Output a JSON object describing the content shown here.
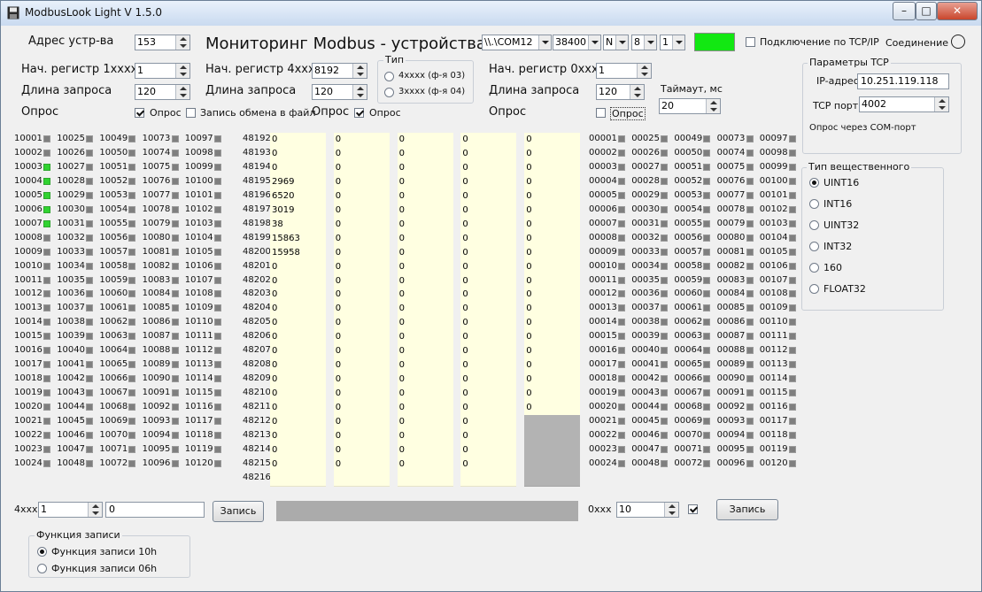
{
  "window": {
    "title": "ModbusLook Light V 1.5.0",
    "min": "–",
    "max": "□",
    "close": "✕"
  },
  "top": {
    "device_address_label": "Адрес устр-ва",
    "device_address": "153",
    "heading": "Мониторинг Modbus - устройства",
    "com_port": "\\\\.\\COM12",
    "baud": "38400",
    "parity": "N",
    "data_bits": "8",
    "stop_bits": "1",
    "status_color": "#12e812",
    "tcp_checkbox_label": "Подключение по TCP/IP",
    "tcp_checked": false,
    "connection_label": "Соединение"
  },
  "panel_1x": {
    "start_label": "Нач. регистр  1xxxx",
    "start": "1",
    "length_label": "Длина запроса",
    "length": "120",
    "poll_label": "Опрос",
    "poll_check_label": "Опрос",
    "poll_checked": true,
    "log_check_label": "Запись обмена в файл",
    "log_checked": false
  },
  "panel_4x": {
    "start_label": "Нач. регистр  4xxxx",
    "start": "8192",
    "length_label": "Длина запроса",
    "length": "120",
    "poll_label": "Опрос",
    "poll_check_label": "Опрос",
    "poll_checked": true,
    "type_group_title": "Тип",
    "type_options": [
      {
        "label": "4xxxx (ф-я 03)",
        "selected": false
      },
      {
        "label": "3xxxx (ф-я 04)",
        "selected": false
      }
    ]
  },
  "panel_0x": {
    "start_label": "Нач. регистр  0xxxx",
    "start": "1",
    "length_label": "Длина запроса",
    "length": "120",
    "poll_label": "Опрос",
    "poll_check_label": "Опрос",
    "poll_checked": false,
    "timeout_label": "Таймаут, мс",
    "timeout": "20"
  },
  "tcp_params": {
    "title": "Параметры TCP",
    "ip_label": "IP-адрес",
    "ip": "10.251.119.118",
    "port_label": "TCP порт",
    "port": "4002",
    "note": "Опрос через COM-порт"
  },
  "real_type": {
    "title": "Тип вещественного",
    "options": [
      {
        "label": "UINT16",
        "selected": true
      },
      {
        "label": "INT16",
        "selected": false
      },
      {
        "label": "UINT32",
        "selected": false
      },
      {
        "label": "INT32",
        "selected": false
      },
      {
        "label": "160",
        "selected": false
      },
      {
        "label": "FLOAT32",
        "selected": false
      }
    ]
  },
  "inputs_1x": {
    "columns": [
      [
        "10001",
        "10002",
        "10003",
        "10004",
        "10005",
        "10006",
        "10007",
        "10008",
        "10009",
        "10010",
        "10011",
        "10012",
        "10013",
        "10014",
        "10015",
        "10016",
        "10017",
        "10018",
        "10019",
        "10020",
        "10021",
        "10022",
        "10023",
        "10024"
      ],
      [
        "10025",
        "10026",
        "10027",
        "10028",
        "10029",
        "10030",
        "10031",
        "10032",
        "10033",
        "10034",
        "10035",
        "10036",
        "10037",
        "10038",
        "10039",
        "10040",
        "10041",
        "10042",
        "10043",
        "10044",
        "10045",
        "10046",
        "10047",
        "10048"
      ],
      [
        "10049",
        "10050",
        "10051",
        "10052",
        "10053",
        "10054",
        "10055",
        "10056",
        "10057",
        "10058",
        "10059",
        "10060",
        "10061",
        "10062",
        "10063",
        "10064",
        "10065",
        "10066",
        "10067",
        "10068",
        "10069",
        "10070",
        "10071",
        "10072"
      ],
      [
        "10073",
        "10074",
        "10075",
        "10076",
        "10077",
        "10078",
        "10079",
        "10080",
        "10081",
        "10082",
        "10083",
        "10084",
        "10085",
        "10086",
        "10087",
        "10088",
        "10089",
        "10090",
        "10091",
        "10092",
        "10093",
        "10094",
        "10095",
        "10096"
      ],
      [
        "10097",
        "10098",
        "10099",
        "10100",
        "10101",
        "10102",
        "10103",
        "10104",
        "10105",
        "10106",
        "10107",
        "10108",
        "10109",
        "10110",
        "10111",
        "10112",
        "10113",
        "10114",
        "10115",
        "10116",
        "10117",
        "10118",
        "10119",
        "10120"
      ]
    ],
    "active": [
      "10003",
      "10004",
      "10005",
      "10006",
      "10007"
    ],
    "on_color": "#31d331",
    "off_color": "#7f7f7f"
  },
  "coils_0x": {
    "columns": [
      [
        "00001",
        "00002",
        "00003",
        "00004",
        "00005",
        "00006",
        "00007",
        "00008",
        "00009",
        "00010",
        "00011",
        "00012",
        "00013",
        "00014",
        "00015",
        "00016",
        "00017",
        "00018",
        "00019",
        "00020",
        "00021",
        "00022",
        "00023",
        "00024"
      ],
      [
        "00025",
        "00026",
        "00027",
        "00028",
        "00029",
        "00030",
        "00031",
        "00032",
        "00033",
        "00034",
        "00035",
        "00036",
        "00037",
        "00038",
        "00039",
        "00040",
        "00041",
        "00042",
        "00043",
        "00044",
        "00045",
        "00046",
        "00047",
        "00048"
      ],
      [
        "00049",
        "00050",
        "00051",
        "00052",
        "00053",
        "00054",
        "00055",
        "00056",
        "00057",
        "00058",
        "00059",
        "00060",
        "00061",
        "00062",
        "00063",
        "00064",
        "00065",
        "00066",
        "00067",
        "00068",
        "00069",
        "00070",
        "00071",
        "00072"
      ],
      [
        "00073",
        "00074",
        "00075",
        "00076",
        "00077",
        "00078",
        "00079",
        "00080",
        "00081",
        "00082",
        "00083",
        "00084",
        "00085",
        "00086",
        "00087",
        "00088",
        "00089",
        "00090",
        "00091",
        "00092",
        "00093",
        "00094",
        "00095",
        "00096"
      ],
      [
        "00097",
        "00098",
        "00099",
        "00100",
        "00101",
        "00102",
        "00103",
        "00104",
        "00105",
        "00106",
        "00107",
        "00108",
        "00109",
        "00110",
        "00111",
        "00112",
        "00113",
        "00114",
        "00115",
        "00116",
        "00117",
        "00118",
        "00119",
        "00120"
      ]
    ],
    "active": []
  },
  "holding_4x": {
    "addresses": [
      "48192",
      "48193",
      "48194",
      "48195",
      "48196",
      "48197",
      "48198",
      "48199",
      "48200",
      "48201",
      "48202",
      "48203",
      "48204",
      "48205",
      "48206",
      "48207",
      "48208",
      "48209",
      "48210",
      "48211",
      "48212",
      "48213",
      "48214",
      "48215",
      "48216"
    ],
    "columns": [
      [
        "0",
        "0",
        "0",
        "2969",
        "6520",
        "3019",
        "38",
        "15863",
        "15958",
        "0",
        "0",
        "0",
        "0",
        "0",
        "0",
        "0",
        "0",
        "0",
        "0",
        "0",
        "0",
        "0",
        "0",
        "0",
        ""
      ],
      [
        "0",
        "0",
        "0",
        "0",
        "0",
        "0",
        "0",
        "0",
        "0",
        "0",
        "0",
        "0",
        "0",
        "0",
        "0",
        "0",
        "0",
        "0",
        "0",
        "0",
        "0",
        "0",
        "0",
        "0",
        ""
      ],
      [
        "0",
        "0",
        "0",
        "0",
        "0",
        "0",
        "0",
        "0",
        "0",
        "0",
        "0",
        "0",
        "0",
        "0",
        "0",
        "0",
        "0",
        "0",
        "0",
        "0",
        "0",
        "0",
        "0",
        "0",
        ""
      ],
      [
        "0",
        "0",
        "0",
        "0",
        "0",
        "0",
        "0",
        "0",
        "0",
        "0",
        "0",
        "0",
        "0",
        "0",
        "0",
        "0",
        "0",
        "0",
        "0",
        "0",
        "0",
        "0",
        "0",
        "0",
        ""
      ],
      [
        "0",
        "0",
        "0",
        "0",
        "0",
        "0",
        "0",
        "0",
        "0",
        "0",
        "0",
        "0",
        "0",
        "0",
        "0",
        "0",
        "0",
        "0",
        "0",
        "0",
        "",
        "",
        "",
        "",
        ""
      ]
    ],
    "cell_color": "#ffffe1",
    "empty_color": "#b3b3b3"
  },
  "write_4x": {
    "label": "4xxx",
    "address": "1",
    "value": "0",
    "button": "Запись"
  },
  "write_0x": {
    "label": "0xxx",
    "address": "10",
    "checked": true,
    "button": "Запись"
  },
  "write_function": {
    "title": "Функция записи",
    "options": [
      {
        "label": "Функция записи 10h",
        "selected": true
      },
      {
        "label": "Функция записи 06h",
        "selected": false
      }
    ]
  }
}
